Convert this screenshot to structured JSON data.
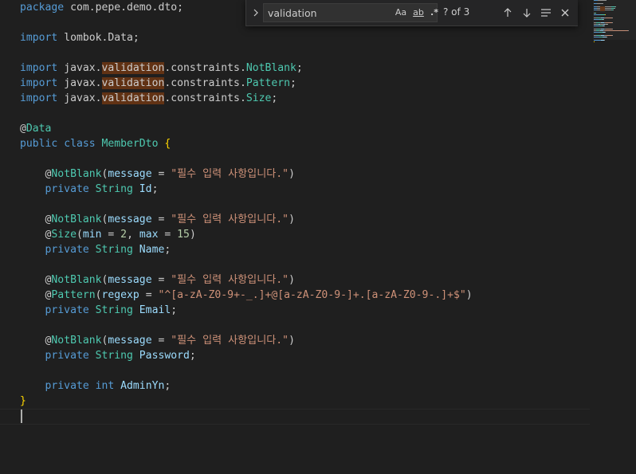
{
  "find_widget": {
    "toggle_icon": "chevron-right-icon",
    "query": "validation",
    "match_case_label": "Aa",
    "whole_word_label": "ab",
    "regex_label": ".*",
    "match_count": "? of 3",
    "icons": {
      "previous": "arrow-up-icon",
      "next": "arrow-down-icon",
      "selection": "find-in-selection-icon",
      "close": "close-icon"
    }
  },
  "editor": {
    "language": "java",
    "lines": [
      [
        {
          "t": "package ",
          "c": "kw"
        },
        {
          "t": "com.pepe.demo.dto",
          "c": "plain"
        },
        {
          "t": ";",
          "c": "plain"
        }
      ],
      [],
      [
        {
          "t": "import ",
          "c": "kw"
        },
        {
          "t": "lombok.Data",
          "c": "plain"
        },
        {
          "t": ";",
          "c": "plain"
        }
      ],
      [],
      [
        {
          "t": "import ",
          "c": "kw"
        },
        {
          "t": "javax.",
          "c": "plain"
        },
        {
          "t": "validation",
          "c": "match"
        },
        {
          "t": ".constraints.",
          "c": "plain"
        },
        {
          "t": "NotBlank",
          "c": "type"
        },
        {
          "t": ";",
          "c": "plain"
        }
      ],
      [
        {
          "t": "import ",
          "c": "kw"
        },
        {
          "t": "javax.",
          "c": "plain"
        },
        {
          "t": "validation",
          "c": "match"
        },
        {
          "t": ".constraints.",
          "c": "plain"
        },
        {
          "t": "Pattern",
          "c": "type"
        },
        {
          "t": ";",
          "c": "plain"
        }
      ],
      [
        {
          "t": "import ",
          "c": "kw"
        },
        {
          "t": "javax.",
          "c": "plain"
        },
        {
          "t": "validation",
          "c": "match"
        },
        {
          "t": ".constraints.",
          "c": "plain"
        },
        {
          "t": "Size",
          "c": "type"
        },
        {
          "t": ";",
          "c": "plain"
        }
      ],
      [],
      [
        {
          "t": "@",
          "c": "plain"
        },
        {
          "t": "Data",
          "c": "type"
        }
      ],
      [
        {
          "t": "public ",
          "c": "kw"
        },
        {
          "t": "class ",
          "c": "kw"
        },
        {
          "t": "MemberDto ",
          "c": "type"
        },
        {
          "t": "{",
          "c": "brace"
        }
      ],
      [],
      [
        {
          "t": "    @",
          "c": "plain"
        },
        {
          "t": "NotBlank",
          "c": "type"
        },
        {
          "t": "(",
          "c": "plain"
        },
        {
          "t": "message",
          "c": "var"
        },
        {
          "t": " = ",
          "c": "plain"
        },
        {
          "t": "\"필수 입력 사항입니다.\"",
          "c": "str"
        },
        {
          "t": ")",
          "c": "plain"
        }
      ],
      [
        {
          "t": "    private ",
          "c": "kw"
        },
        {
          "t": "String ",
          "c": "type"
        },
        {
          "t": "Id",
          "c": "var"
        },
        {
          "t": ";",
          "c": "plain"
        }
      ],
      [],
      [
        {
          "t": "    @",
          "c": "plain"
        },
        {
          "t": "NotBlank",
          "c": "type"
        },
        {
          "t": "(",
          "c": "plain"
        },
        {
          "t": "message",
          "c": "var"
        },
        {
          "t": " = ",
          "c": "plain"
        },
        {
          "t": "\"필수 입력 사항입니다.\"",
          "c": "str"
        },
        {
          "t": ")",
          "c": "plain"
        }
      ],
      [
        {
          "t": "    @",
          "c": "plain"
        },
        {
          "t": "Size",
          "c": "type"
        },
        {
          "t": "(",
          "c": "plain"
        },
        {
          "t": "min",
          "c": "var"
        },
        {
          "t": " = ",
          "c": "plain"
        },
        {
          "t": "2",
          "c": "num"
        },
        {
          "t": ", ",
          "c": "plain"
        },
        {
          "t": "max",
          "c": "var"
        },
        {
          "t": " = ",
          "c": "plain"
        },
        {
          "t": "15",
          "c": "num"
        },
        {
          "t": ")",
          "c": "plain"
        }
      ],
      [
        {
          "t": "    private ",
          "c": "kw"
        },
        {
          "t": "String ",
          "c": "type"
        },
        {
          "t": "Name",
          "c": "var"
        },
        {
          "t": ";",
          "c": "plain"
        }
      ],
      [],
      [
        {
          "t": "    @",
          "c": "plain"
        },
        {
          "t": "NotBlank",
          "c": "type"
        },
        {
          "t": "(",
          "c": "plain"
        },
        {
          "t": "message",
          "c": "var"
        },
        {
          "t": " = ",
          "c": "plain"
        },
        {
          "t": "\"필수 입력 사항입니다.\"",
          "c": "str"
        },
        {
          "t": ")",
          "c": "plain"
        }
      ],
      [
        {
          "t": "    @",
          "c": "plain"
        },
        {
          "t": "Pattern",
          "c": "type"
        },
        {
          "t": "(",
          "c": "plain"
        },
        {
          "t": "regexp",
          "c": "var"
        },
        {
          "t": " = ",
          "c": "plain"
        },
        {
          "t": "\"^[a-zA-Z0-9+-_.]+@[a-zA-Z0-9-]+.[a-zA-Z0-9-.]+$\"",
          "c": "str"
        },
        {
          "t": ")",
          "c": "plain"
        }
      ],
      [
        {
          "t": "    private ",
          "c": "kw"
        },
        {
          "t": "String ",
          "c": "type"
        },
        {
          "t": "Email",
          "c": "var"
        },
        {
          "t": ";",
          "c": "plain"
        }
      ],
      [],
      [
        {
          "t": "    @",
          "c": "plain"
        },
        {
          "t": "NotBlank",
          "c": "type"
        },
        {
          "t": "(",
          "c": "plain"
        },
        {
          "t": "message",
          "c": "var"
        },
        {
          "t": " = ",
          "c": "plain"
        },
        {
          "t": "\"필수 입력 사항입니다.\"",
          "c": "str"
        },
        {
          "t": ")",
          "c": "plain"
        }
      ],
      [
        {
          "t": "    private ",
          "c": "kw"
        },
        {
          "t": "String ",
          "c": "type"
        },
        {
          "t": "Password",
          "c": "var"
        },
        {
          "t": ";",
          "c": "plain"
        }
      ],
      [],
      [
        {
          "t": "    private ",
          "c": "kw"
        },
        {
          "t": "int ",
          "c": "kw"
        },
        {
          "t": "AdminYn",
          "c": "var"
        },
        {
          "t": ";",
          "c": "plain"
        }
      ],
      [
        {
          "t": "}",
          "c": "brace"
        }
      ],
      []
    ]
  },
  "colors": {
    "background": "#1f1f1f",
    "keyword": "#569cd6",
    "type": "#4ec9b0",
    "string": "#ce9178",
    "number": "#b5cea8",
    "variable": "#9cdcfe",
    "match_highlight": "#613214"
  }
}
